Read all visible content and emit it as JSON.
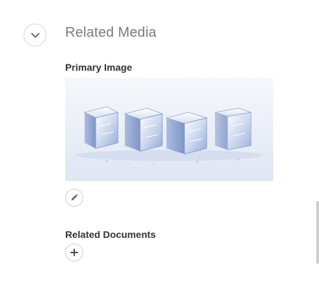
{
  "section": {
    "title": "Related Media",
    "toggle_icon": "chevron-down-icon"
  },
  "primary_image": {
    "label": "Primary Image",
    "edit_icon": "pencil-icon"
  },
  "related_documents": {
    "label": "Related Documents",
    "add_icon": "plus-icon"
  },
  "colors": {
    "title": "#7a7a7a",
    "label": "#333333",
    "border": "#d6d6d6"
  }
}
